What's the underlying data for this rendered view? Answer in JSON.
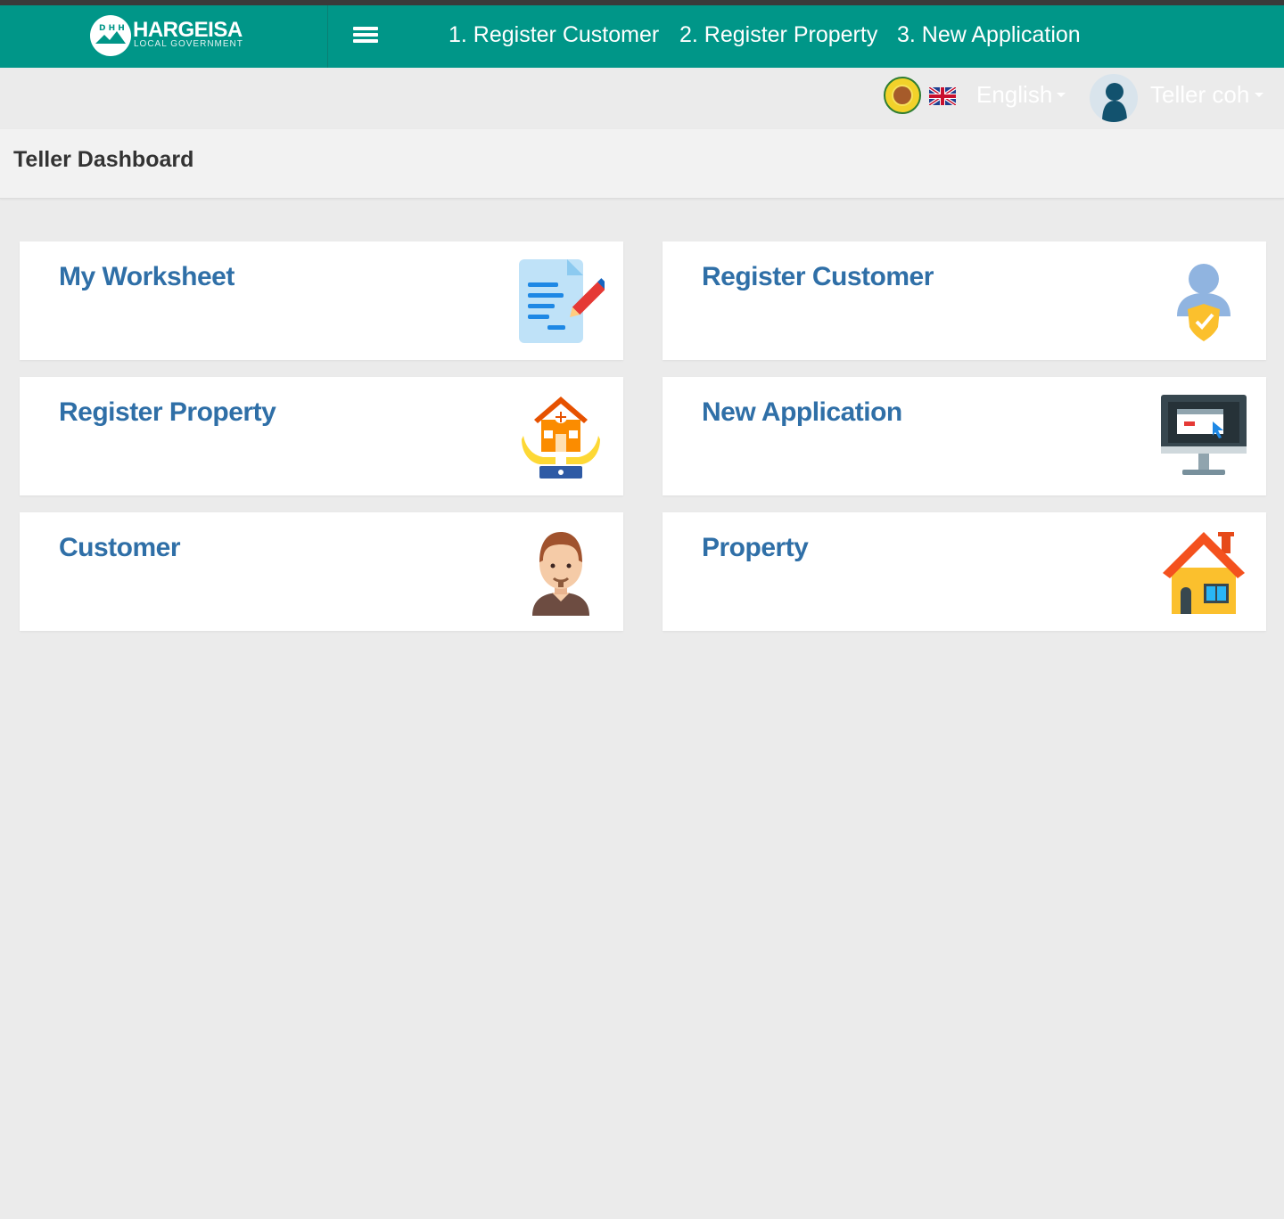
{
  "brand": {
    "title": "HARGEISA",
    "subtitle": "LOCAL GOVERNMENT",
    "logo_letters": "D H H"
  },
  "nav": {
    "menu_icon": "hamburger-menu-icon",
    "links": [
      "1. Register Customer",
      "2. Register Property",
      "3. New Application"
    ]
  },
  "subbar": {
    "seal_icon": "government-seal-icon",
    "flag_icon": "uk-flag-icon",
    "language": "English",
    "avatar_icon": "user-avatar-icon",
    "user": "Teller coh"
  },
  "page": {
    "title": "Teller Dashboard"
  },
  "cards": [
    {
      "label": "My Worksheet",
      "icon": "worksheet-edit-icon"
    },
    {
      "label": "Register Customer",
      "icon": "user-shield-icon"
    },
    {
      "label": "Register Property",
      "icon": "house-in-hands-icon"
    },
    {
      "label": "New Application",
      "icon": "monitor-application-icon"
    },
    {
      "label": "Customer",
      "icon": "man-avatar-icon"
    },
    {
      "label": "Property",
      "icon": "house-icon"
    }
  ],
  "colors": {
    "navbar": "#009688",
    "card_title": "#2f6fa7",
    "background": "#ebebeb"
  }
}
